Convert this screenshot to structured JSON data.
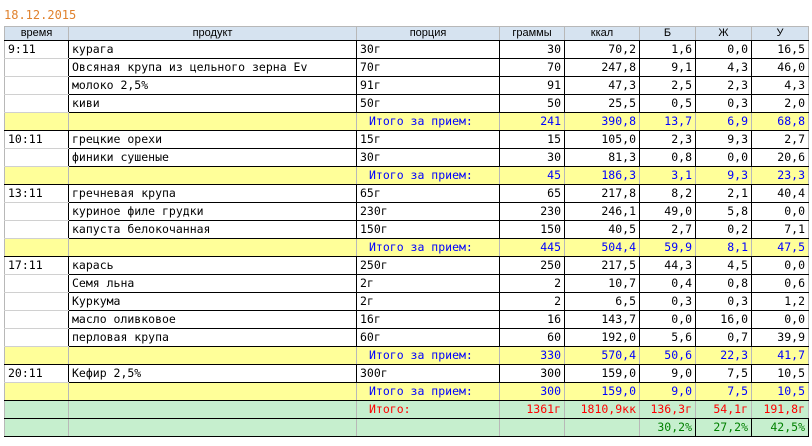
{
  "date": "18.12.2015",
  "headers": {
    "time": "время",
    "product": "продукт",
    "portion": "порция",
    "grams": "граммы",
    "kcal": "ккал",
    "b": "Б",
    "zh": "Ж",
    "u": "У"
  },
  "meals": [
    {
      "time": "9:11",
      "items": [
        {
          "product": "курага",
          "portion": "30г",
          "grams": "30",
          "kcal": "70,2",
          "b": "1,6",
          "zh": "0,0",
          "u": "16,5"
        },
        {
          "product": "Овсяная крупа из цельного зерна Ev",
          "portion": "70г",
          "grams": "70",
          "kcal": "247,8",
          "b": "9,1",
          "zh": "4,3",
          "u": "46,0"
        },
        {
          "product": "молоко 2,5%",
          "portion": "91г",
          "grams": "91",
          "kcal": "47,3",
          "b": "2,5",
          "zh": "2,3",
          "u": "4,3"
        },
        {
          "product": "киви",
          "portion": "50г",
          "grams": "50",
          "kcal": "25,5",
          "b": "0,5",
          "zh": "0,3",
          "u": "2,0"
        }
      ],
      "subtotal": {
        "label": "Итого за прием:",
        "grams": "241",
        "kcal": "390,8",
        "b": "13,7",
        "zh": "6,9",
        "u": "68,8"
      }
    },
    {
      "time": "10:11",
      "items": [
        {
          "product": "грецкие орехи",
          "portion": "15г",
          "grams": "15",
          "kcal": "105,0",
          "b": "2,3",
          "zh": "9,3",
          "u": "2,7"
        },
        {
          "product": "финики сушеные",
          "portion": "30г",
          "grams": "30",
          "kcal": "81,3",
          "b": "0,8",
          "zh": "0,0",
          "u": "20,6"
        }
      ],
      "subtotal": {
        "label": "Итого за прием:",
        "grams": "45",
        "kcal": "186,3",
        "b": "3,1",
        "zh": "9,3",
        "u": "23,3"
      }
    },
    {
      "time": "13:11",
      "items": [
        {
          "product": "гречневая крупа",
          "portion": "65г",
          "grams": "65",
          "kcal": "217,8",
          "b": "8,2",
          "zh": "2,1",
          "u": "40,4"
        },
        {
          "product": "куриное филе грудки",
          "portion": "230г",
          "grams": "230",
          "kcal": "246,1",
          "b": "49,0",
          "zh": "5,8",
          "u": "0,0"
        },
        {
          "product": "капуста белокочанная",
          "portion": "150г",
          "grams": "150",
          "kcal": "40,5",
          "b": "2,7",
          "zh": "0,2",
          "u": "7,1"
        }
      ],
      "subtotal": {
        "label": "Итого за прием:",
        "grams": "445",
        "kcal": "504,4",
        "b": "59,9",
        "zh": "8,1",
        "u": "47,5"
      }
    },
    {
      "time": "17:11",
      "items": [
        {
          "product": "карась",
          "portion": "250г",
          "grams": "250",
          "kcal": "217,5",
          "b": "44,3",
          "zh": "4,5",
          "u": "0,0"
        },
        {
          "product": "Семя льна",
          "portion": "2г",
          "grams": "2",
          "kcal": "10,7",
          "b": "0,4",
          "zh": "0,8",
          "u": "0,6"
        },
        {
          "product": "Куркума",
          "portion": "2г",
          "grams": "2",
          "kcal": "6,5",
          "b": "0,3",
          "zh": "0,3",
          "u": "1,2"
        },
        {
          "product": "масло оливковое",
          "portion": "16г",
          "grams": "16",
          "kcal": "143,7",
          "b": "0,0",
          "zh": "16,0",
          "u": "0,0"
        },
        {
          "product": "перловая крупа",
          "portion": "60г",
          "grams": "60",
          "kcal": "192,0",
          "b": "5,6",
          "zh": "0,7",
          "u": "39,9"
        }
      ],
      "subtotal": {
        "label": "Итого за прием:",
        "grams": "330",
        "kcal": "570,4",
        "b": "50,6",
        "zh": "22,3",
        "u": "41,7"
      }
    },
    {
      "time": "20:11",
      "items": [
        {
          "product": "Кефир 2,5%",
          "portion": "300г",
          "grams": "300",
          "kcal": "159,0",
          "b": "9,0",
          "zh": "7,5",
          "u": "10,5"
        }
      ],
      "subtotal": {
        "label": "Итого за прием:",
        "grams": "300",
        "kcal": "159,0",
        "b": "9,0",
        "zh": "7,5",
        "u": "10,5"
      }
    }
  ],
  "total": {
    "label": "Итого:",
    "grams": "1361г",
    "kcal": "1810,9кк",
    "b": "136,3г",
    "zh": "54,1г",
    "u": "191,8г"
  },
  "percent": {
    "b": "30,2%",
    "zh": "27,2%",
    "u": "42,5%"
  }
}
